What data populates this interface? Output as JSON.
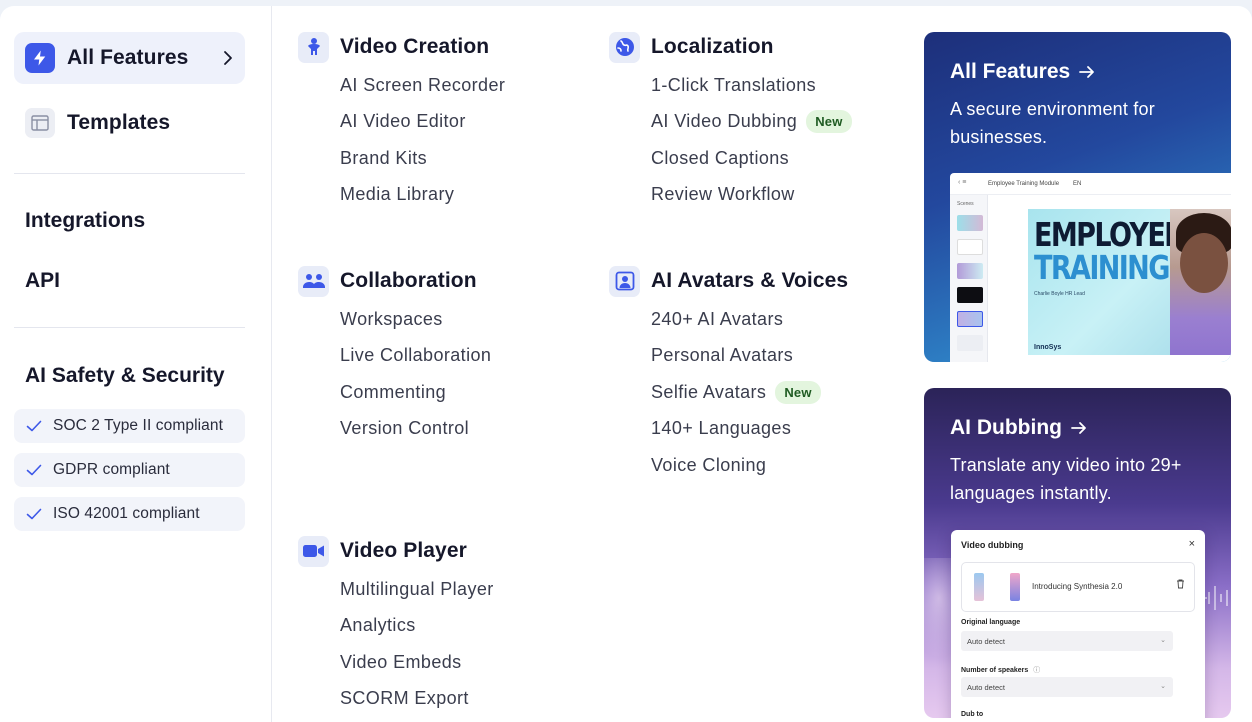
{
  "sidebar": {
    "all_features": "All Features",
    "templates": "Templates",
    "integrations": "Integrations",
    "api": "API",
    "security_heading": "AI Safety & Security",
    "badges": [
      "SOC 2 Type II compliant",
      "GDPR compliant",
      "ISO 42001 compliant"
    ]
  },
  "groups": {
    "video_creation": {
      "title": "Video Creation",
      "items": [
        "AI Screen Recorder",
        "AI Video Editor",
        "Brand Kits",
        "Media Library"
      ]
    },
    "collaboration": {
      "title": "Collaboration",
      "items": [
        "Workspaces",
        "Live Collaboration",
        "Commenting",
        "Version Control"
      ]
    },
    "video_player": {
      "title": "Video Player",
      "items": [
        "Multilingual Player",
        "Analytics",
        "Video Embeds",
        "SCORM Export"
      ]
    },
    "localization": {
      "title": "Localization",
      "items": [
        "1-Click Translations",
        "AI Video Dubbing",
        "Closed Captions",
        "Review Workflow"
      ]
    },
    "avatars": {
      "title": "AI Avatars & Voices",
      "items": [
        "240+ AI Avatars",
        "Personal Avatars",
        "Selfie Avatars",
        "140+ Languages",
        "Voice Cloning"
      ]
    }
  },
  "new_badge": "New",
  "cards": {
    "all_features": {
      "title": "All Features",
      "text": "A secure environment for businesses.",
      "mock": {
        "topbar": "Employee Training Module",
        "topbar_tag": "EN",
        "scenes_label": "Scenes",
        "headline_1": "EMPLOYEE",
        "headline_2": "TRAINING",
        "byline": "Charlie Boyle HR Lead",
        "logo": "InnoSys"
      }
    },
    "dubbing": {
      "title": "AI Dubbing",
      "text": "Translate any video into 29+ languages instantly.",
      "mock": {
        "header": "Video dubbing",
        "close": "×",
        "file_name": "Introducing Synthesia 2.0",
        "original_language_label": "Original language",
        "original_language_value": "Auto detect",
        "speakers_label": "Number of speakers",
        "speakers_value": "Auto detect",
        "dub_to_label": "Dub to"
      }
    }
  },
  "colors": {
    "accent": "#3d58e8",
    "text": "#15172a",
    "new_badge_bg": "#e3f5de",
    "new_badge_text": "#1f5b22"
  }
}
